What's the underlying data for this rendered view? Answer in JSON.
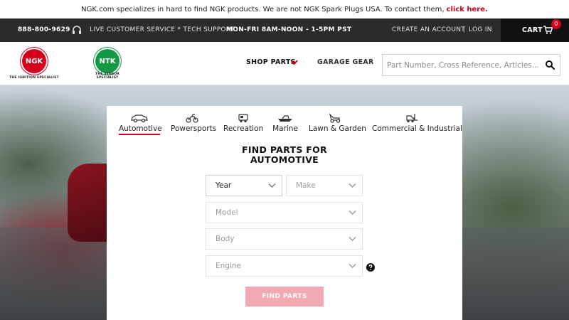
{
  "announcement": {
    "text": "NGK.com specializes in hard to find NGK products. We are not NGK Spark Plugs USA. To contact them,",
    "link": "click here."
  },
  "utility": {
    "phone": "888-800-9629",
    "service": "LIVE CUSTOMER SERVICE * TECH SUPPORT",
    "hours": "MON-FRI 8AM-NOON - 1-5PM PST",
    "create_account": "CREATE AN ACCOUNT",
    "separator": "|",
    "login": "LOG IN",
    "cart_label": "CART",
    "cart_count": "0"
  },
  "header": {
    "logo_ngk": {
      "mark": "NGK",
      "tagline": "THE IGNITION SPECIALIST"
    },
    "logo_ntk": {
      "mark": "NTK",
      "tagline": "THE SENSOR SPECIALIST"
    },
    "nav_shop_parts": "SHOP PARTS",
    "nav_garage_gear": "GARAGE GEAR",
    "search_placeholder": "Part Number, Cross Reference, Articles..."
  },
  "finder": {
    "tabs": [
      {
        "label": "Automotive",
        "icon": "car-icon",
        "active": true
      },
      {
        "label": "Powersports",
        "icon": "motorcycle-icon",
        "active": false
      },
      {
        "label": "Recreation",
        "icon": "rv-icon",
        "active": false
      },
      {
        "label": "Marine",
        "icon": "boat-icon",
        "active": false
      },
      {
        "label": "Lawn & Garden",
        "icon": "mower-icon",
        "active": false
      },
      {
        "label": "Commercial & Industrial",
        "icon": "forklift-icon",
        "active": false
      }
    ],
    "title_line1": "FIND PARTS FOR",
    "title_line2": "AUTOMOTIVE",
    "selects": {
      "year": "Year",
      "make": "Make",
      "model": "Model",
      "body": "Body",
      "engine": "Engine"
    },
    "button": "FIND PARTS"
  },
  "colors": {
    "brand_red": "#d6001c",
    "brand_green": "#119944",
    "utility_bar": "#2b2b2b",
    "button_disabled": "#f2a9b1"
  }
}
